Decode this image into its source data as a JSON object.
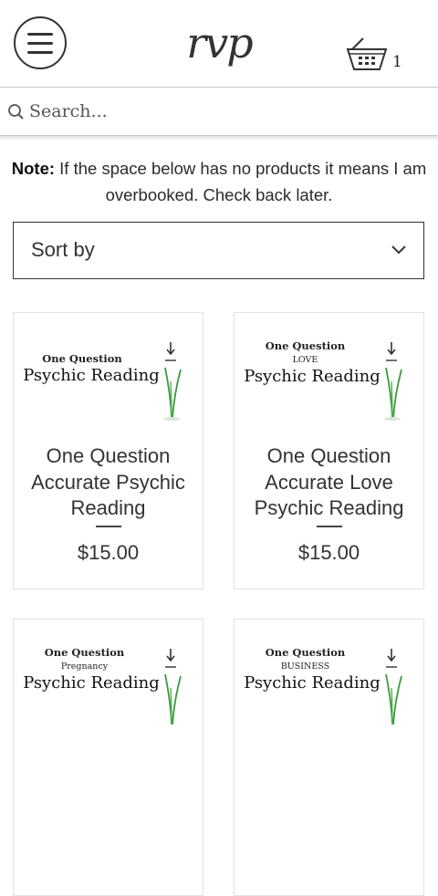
{
  "header": {
    "logo_text": "rvp",
    "cart_count": "1"
  },
  "search": {
    "placeholder": "Search..."
  },
  "note": {
    "label": "Note:",
    "text": " If the space below has no products it means I am overbooked. Check back later."
  },
  "sort": {
    "label": "Sort by"
  },
  "products": [
    {
      "image_small": "One Question",
      "image_sub": "",
      "image_big": "Psychic Reading",
      "title": "One Question Accurate Psychic Reading",
      "price": "$15.00"
    },
    {
      "image_small": "One Question",
      "image_sub": "LOVE",
      "image_big": "Psychic Reading",
      "title": "One Question Accurate Love Psychic Reading",
      "price": "$15.00"
    },
    {
      "image_small": "One Question",
      "image_sub": "Pregnancy",
      "image_big": "Psychic Reading",
      "title": "",
      "price": ""
    },
    {
      "image_small": "One Question",
      "image_sub": "BUSINESS",
      "image_big": "Psychic Reading",
      "title": "",
      "price": ""
    }
  ],
  "icons": {
    "menu": "hamburger-menu-icon",
    "cart": "shopping-basket-icon",
    "search": "magnifier-icon",
    "sort": "chevron-down-icon",
    "product_image_decor": "grass-sprig-icon"
  },
  "colors": {
    "text": "#2b2b2b",
    "border": "#333333",
    "card_border": "#e2e2e2",
    "plant_green": "#3a9a3a"
  }
}
